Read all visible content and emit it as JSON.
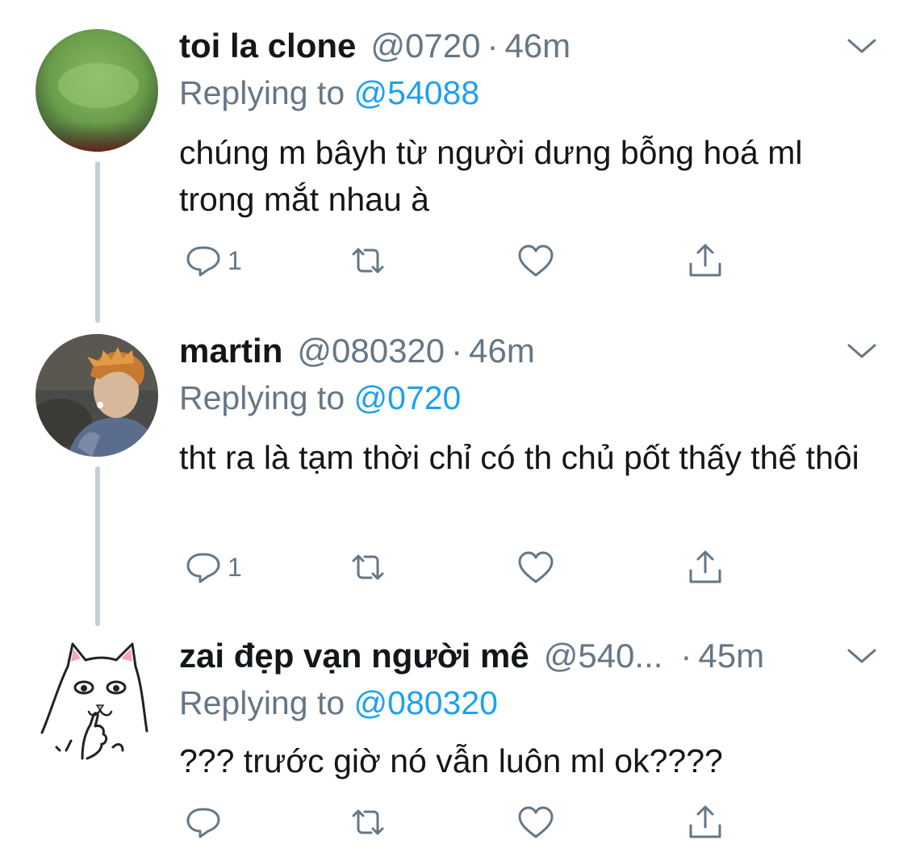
{
  "tweets": [
    {
      "name": "toi la clone",
      "handle": "@0720",
      "separator": "·",
      "time": "46m",
      "replying_prefix": "Replying to",
      "replying_to": "@54088",
      "text": "chúng m bâyh từ người dưng bỗng hoá ml trong mắt nhau à",
      "reply_count": "1",
      "retweet_count": "",
      "like_count": "",
      "avatar_icon": "green-blurry-avatar-icon"
    },
    {
      "name": "martin",
      "handle": "@080320",
      "separator": "·",
      "time": "46m",
      "replying_prefix": "Replying to",
      "replying_to": "@0720",
      "text": "tht ra là tạm thời chỉ có th chủ pốt thấy thế thôi",
      "reply_count": "1",
      "retweet_count": "",
      "like_count": "",
      "avatar_icon": "person-photo-avatar-icon"
    },
    {
      "name": "zai đẹp vạn người mê",
      "handle": "@540...",
      "separator": "·",
      "time": "45m",
      "replying_prefix": "Replying to",
      "replying_to": "@080320",
      "text": "??? trước giờ nó vẫn luôn ml ok????",
      "reply_count": "",
      "retweet_count": "",
      "like_count": "",
      "avatar_icon": "cat-sketch-avatar-icon"
    }
  ],
  "colors": {
    "text_primary": "#14171a",
    "text_secondary": "#657786",
    "mention_blue": "#1da1f2",
    "thread_line": "#c4cfd6",
    "icon_gray": "#657786"
  },
  "icons": {
    "reply": "reply-icon",
    "retweet": "retweet-icon",
    "like": "heart-icon",
    "share": "share-icon",
    "more": "chevron-down-icon"
  }
}
